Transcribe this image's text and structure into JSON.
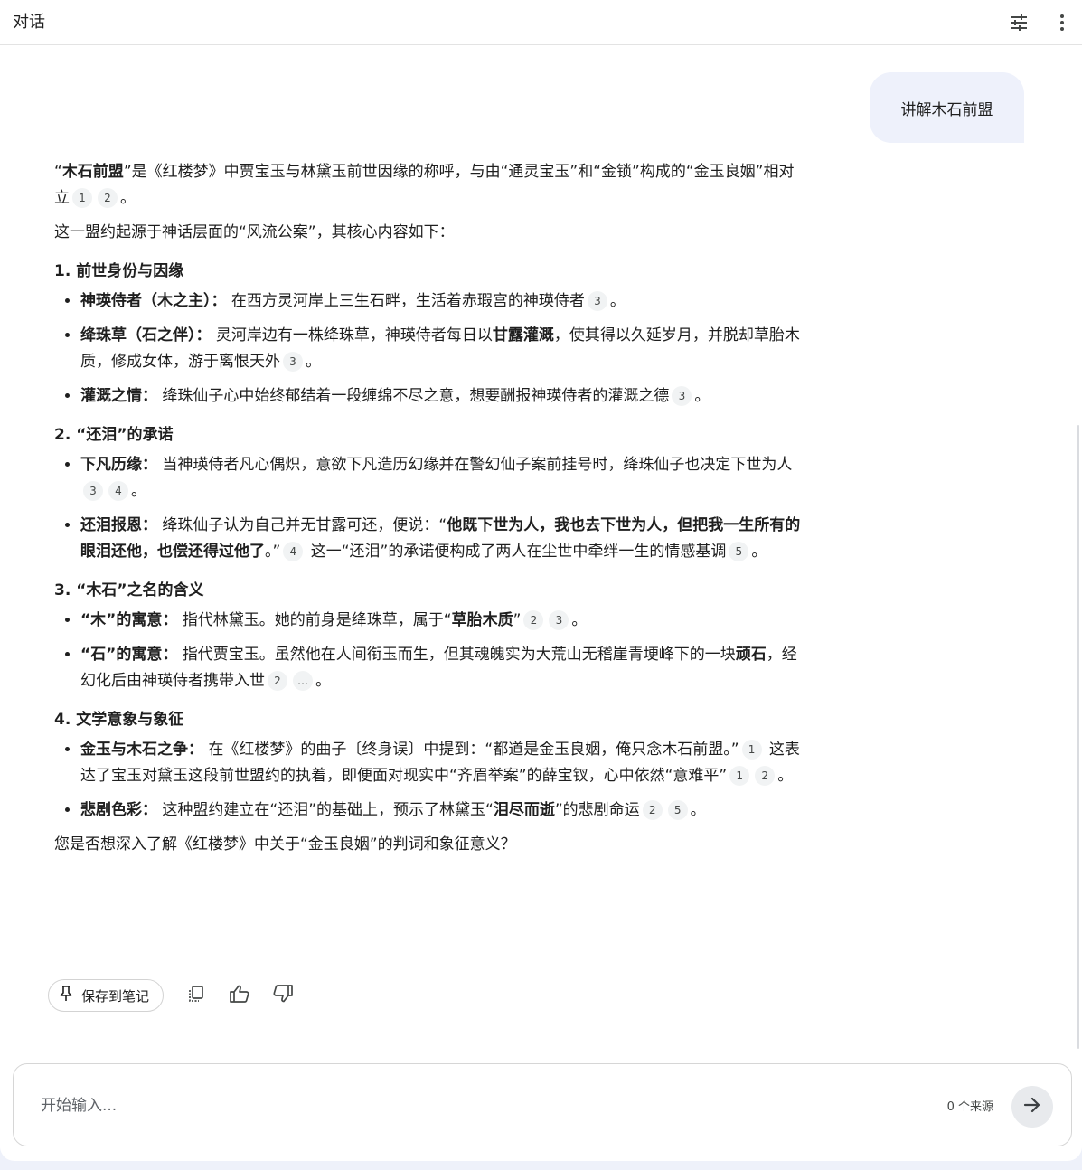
{
  "header": {
    "title": "对话"
  },
  "user_message": "讲解木石前盟",
  "answer": {
    "intro": {
      "b1": "木石前盟",
      "t1": "”是《红楼梦》中贾宝玉与林黛玉前世因缘的称呼，与由“通灵宝玉”和“金锁”构成的“金玉良姻”相对立",
      "q": "“",
      "c1": "1",
      "c2": "2",
      "end": "。"
    },
    "p2": "这一盟约起源于神话层面的“风流公案”，其核心内容如下：",
    "s1": {
      "title": "1. 前世身份与因缘",
      "i1": {
        "label": "神瑛侍者（木之主）：",
        "text": " 在西方灵河岸上三生石畔，生活着赤瑕宫的神瑛侍者",
        "c1": "3",
        "end": "。"
      },
      "i2": {
        "label": "绛珠草（石之伴）：",
        "t1": " 灵河岸边有一株绛珠草，神瑛侍者每日以",
        "b": "甘露灌溉",
        "t2": "，使其得以久延岁月，并脱却草胎木质，修成女体，游于离恨天外",
        "c1": "3",
        "end": "。"
      },
      "i3": {
        "label": "灌溉之情：",
        "text": " 绛珠仙子心中始终郁结着一段缠绵不尽之意，想要酬报神瑛侍者的灌溉之德",
        "c1": "3",
        "end": "。"
      }
    },
    "s2": {
      "title": "2. “还泪”的承诺",
      "i1": {
        "label": "下凡历缘：",
        "text": " 当神瑛侍者凡心偶炽，意欲下凡造历幻缘并在警幻仙子案前挂号时，绛珠仙子也决定下世为人",
        "c1": "3",
        "c2": "4",
        "end": "。"
      },
      "i2": {
        "label": "还泪报恩：",
        "t1": " 绛珠仙子认为自己并无甘露可还，便说：“",
        "b": "他既下世为人，我也去下世为人，但把我一生所有的眼泪还他，也偿还得过他了",
        "t2": "。”",
        "c1": "4",
        "t3": " 这一“还泪”的承诺便构成了两人在尘世中牵绊一生的情感基调",
        "c2": "5",
        "end": "。"
      }
    },
    "s3": {
      "title": "3. “木石”之名的含义",
      "i1": {
        "label": "“木”的寓意：",
        "t1": " 指代林黛玉。她的前身是绛珠草，属于“",
        "b": "草胎木质",
        "t2": "”",
        "c1": "2",
        "c2": "3",
        "end": "。"
      },
      "i2": {
        "label": "“石”的寓意：",
        "t1": " 指代贾宝玉。虽然他在人间衔玉而生，但其魂魄实为大荒山无稽崖青埂峰下的一块",
        "b": "顽石",
        "t2": "，经幻化后由神瑛侍者携带入世",
        "c1": "2",
        "c2": "…",
        "end": "。"
      }
    },
    "s4": {
      "title": "4. 文学意象与象征",
      "i1": {
        "label": "金玉与木石之争：",
        "t1": " 在《红楼梦》的曲子〔终身误〕中提到：“都道是金玉良姻，俺只念木石前盟。”",
        "c1": "1",
        "t2": " 这表达了宝玉对黛玉这段前世盟约的执着，即便面对现实中“齐眉举案”的薛宝钗，心中依然“意难平”",
        "c2": "1",
        "c3": "2",
        "end": "。"
      },
      "i2": {
        "label": "悲剧色彩：",
        "t1": " 这种盟约建立在“还泪”的基础上，预示了林黛玉“",
        "b": "泪尽而逝",
        "t2": "”的悲剧命运",
        "c1": "2",
        "c2": "5",
        "end": "。"
      }
    },
    "closing": "您是否想深入了解《红楼梦》中关于“金玉良姻”的判词和象征意义？"
  },
  "actions": {
    "save_label": "保存到笔记"
  },
  "composer": {
    "placeholder": "开始输入...",
    "source_count": "0 个来源"
  },
  "icons": {
    "tune": "tune-icon",
    "more": "more-vert-icon",
    "pin": "pin-icon",
    "copy": "copy-icon",
    "thumb_up": "thumb-up-icon",
    "thumb_down": "thumb-down-icon",
    "send": "arrow-forward-icon"
  }
}
